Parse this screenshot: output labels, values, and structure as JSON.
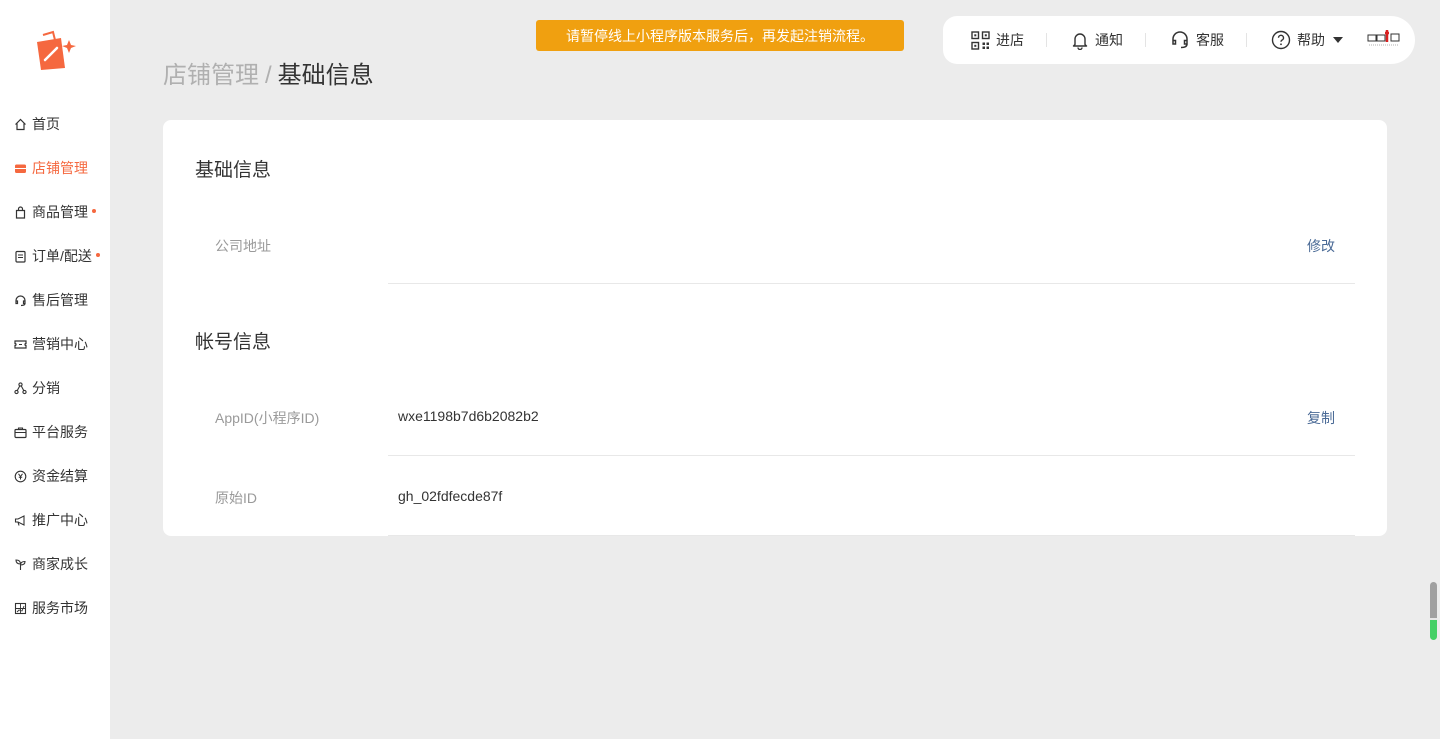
{
  "banner": {
    "text": "请暂停线上小程序版本服务后，再发起注销流程。"
  },
  "topbar": {
    "enter_store": "进店",
    "notifications": "通知",
    "customer_service": "客服",
    "help": "帮助"
  },
  "sidebar": {
    "items": [
      {
        "label": "首页",
        "icon": "home-icon"
      },
      {
        "label": "店铺管理",
        "icon": "store-icon",
        "active": true
      },
      {
        "label": "商品管理",
        "icon": "bag-icon",
        "badge": true
      },
      {
        "label": "订单/配送",
        "icon": "clipboard-icon",
        "badge": true
      },
      {
        "label": "售后管理",
        "icon": "headset-icon"
      },
      {
        "label": "营销中心",
        "icon": "ticket-icon"
      },
      {
        "label": "分销",
        "icon": "share-network-icon"
      },
      {
        "label": "平台服务",
        "icon": "briefcase-icon"
      },
      {
        "label": "资金结算",
        "icon": "yen-coin-icon"
      },
      {
        "label": "推广中心",
        "icon": "megaphone-icon"
      },
      {
        "label": "商家成长",
        "icon": "sprout-icon"
      },
      {
        "label": "服务市场",
        "icon": "grid-chart-icon"
      }
    ]
  },
  "breadcrumb": {
    "parent": "店铺管理",
    "separator": "/",
    "current": "基础信息"
  },
  "basic_info": {
    "title": "基础信息",
    "company_address_label": "公司地址",
    "company_address_value": "",
    "edit_label": "修改"
  },
  "account_info": {
    "title": "帐号信息",
    "appid_label": "AppID(小程序ID)",
    "appid_value": "wxe1198b7d6b2082b2",
    "copy_label": "复制",
    "original_id_label": "原始ID",
    "original_id_value": "gh_02fdfecde87f"
  },
  "colors": {
    "accent": "#f5683f",
    "banner": "#f0a010",
    "link": "#4a6a96",
    "background": "#ececec"
  }
}
